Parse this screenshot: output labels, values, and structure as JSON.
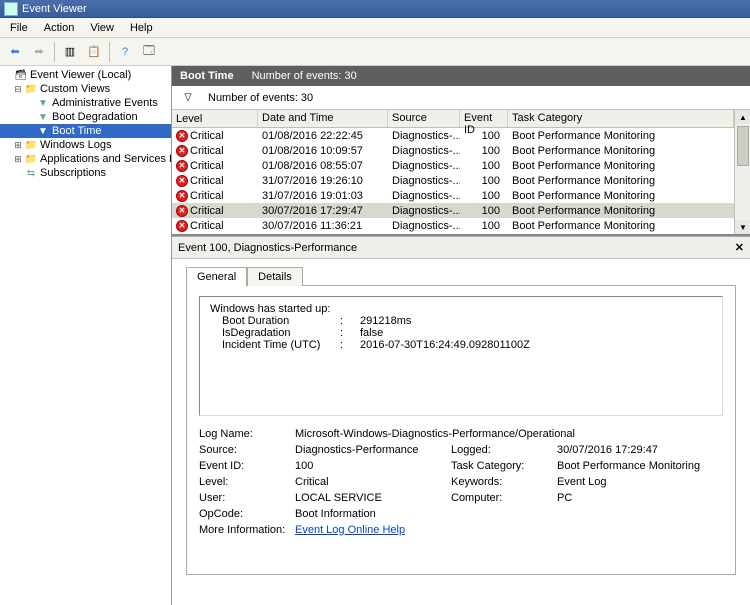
{
  "title": "Event Viewer",
  "menu": [
    "File",
    "Action",
    "View",
    "Help"
  ],
  "tree": {
    "root": "Event Viewer (Local)",
    "custom_views": "Custom Views",
    "admin_events": "Administrative Events",
    "boot_degradation": "Boot Degradation",
    "boot_time": "Boot Time",
    "windows_logs": "Windows Logs",
    "app_services_logs": "Applications and Services Logs",
    "subscriptions": "Subscriptions"
  },
  "header": {
    "title": "Boot Time",
    "subtitle": "Number of events: 30"
  },
  "filter": {
    "count": "Number of events: 30"
  },
  "columns": [
    "Level",
    "Date and Time",
    "Source",
    "Event ID",
    "Task Category"
  ],
  "rows": [
    {
      "level": "Critical",
      "dt": "01/08/2016 22:22:45",
      "src": "Diagnostics-...",
      "id": "100",
      "cat": "Boot Performance Monitoring",
      "sel": false
    },
    {
      "level": "Critical",
      "dt": "01/08/2016 10:09:57",
      "src": "Diagnostics-...",
      "id": "100",
      "cat": "Boot Performance Monitoring",
      "sel": false
    },
    {
      "level": "Critical",
      "dt": "01/08/2016 08:55:07",
      "src": "Diagnostics-...",
      "id": "100",
      "cat": "Boot Performance Monitoring",
      "sel": false
    },
    {
      "level": "Critical",
      "dt": "31/07/2016 19:26:10",
      "src": "Diagnostics-...",
      "id": "100",
      "cat": "Boot Performance Monitoring",
      "sel": false
    },
    {
      "level": "Critical",
      "dt": "31/07/2016 19:01:03",
      "src": "Diagnostics-...",
      "id": "100",
      "cat": "Boot Performance Monitoring",
      "sel": false
    },
    {
      "level": "Critical",
      "dt": "30/07/2016 17:29:47",
      "src": "Diagnostics-...",
      "id": "100",
      "cat": "Boot Performance Monitoring",
      "sel": true
    },
    {
      "level": "Critical",
      "dt": "30/07/2016 11:36:21",
      "src": "Diagnostics-...",
      "id": "100",
      "cat": "Boot Performance Monitoring",
      "sel": false
    }
  ],
  "detail_header": "Event 100, Diagnostics-Performance",
  "tabs": {
    "general": "General",
    "details": "Details"
  },
  "info": {
    "heading": "Windows has started up:",
    "boot_duration_k": "Boot Duration",
    "boot_duration_v": "291218ms",
    "is_degradation_k": "IsDegradation",
    "is_degradation_v": "false",
    "incident_time_k": "Incident Time (UTC)",
    "incident_time_v": "2016-07-30T16:24:49.092801100Z"
  },
  "fields": {
    "log_name_k": "Log Name:",
    "log_name_v": "Microsoft-Windows-Diagnostics-Performance/Operational",
    "source_k": "Source:",
    "source_v": "Diagnostics-Performance",
    "logged_k": "Logged:",
    "logged_v": "30/07/2016 17:29:47",
    "event_id_k": "Event ID:",
    "event_id_v": "100",
    "task_cat_k": "Task Category:",
    "task_cat_v": "Boot Performance Monitoring",
    "level_k": "Level:",
    "level_v": "Critical",
    "keywords_k": "Keywords:",
    "keywords_v": "Event Log",
    "user_k": "User:",
    "user_v": "LOCAL SERVICE",
    "computer_k": "Computer:",
    "computer_v": "PC",
    "opcode_k": "OpCode:",
    "opcode_v": "Boot Information",
    "more_info_k": "More Information:",
    "more_info_v": "Event Log Online Help"
  }
}
